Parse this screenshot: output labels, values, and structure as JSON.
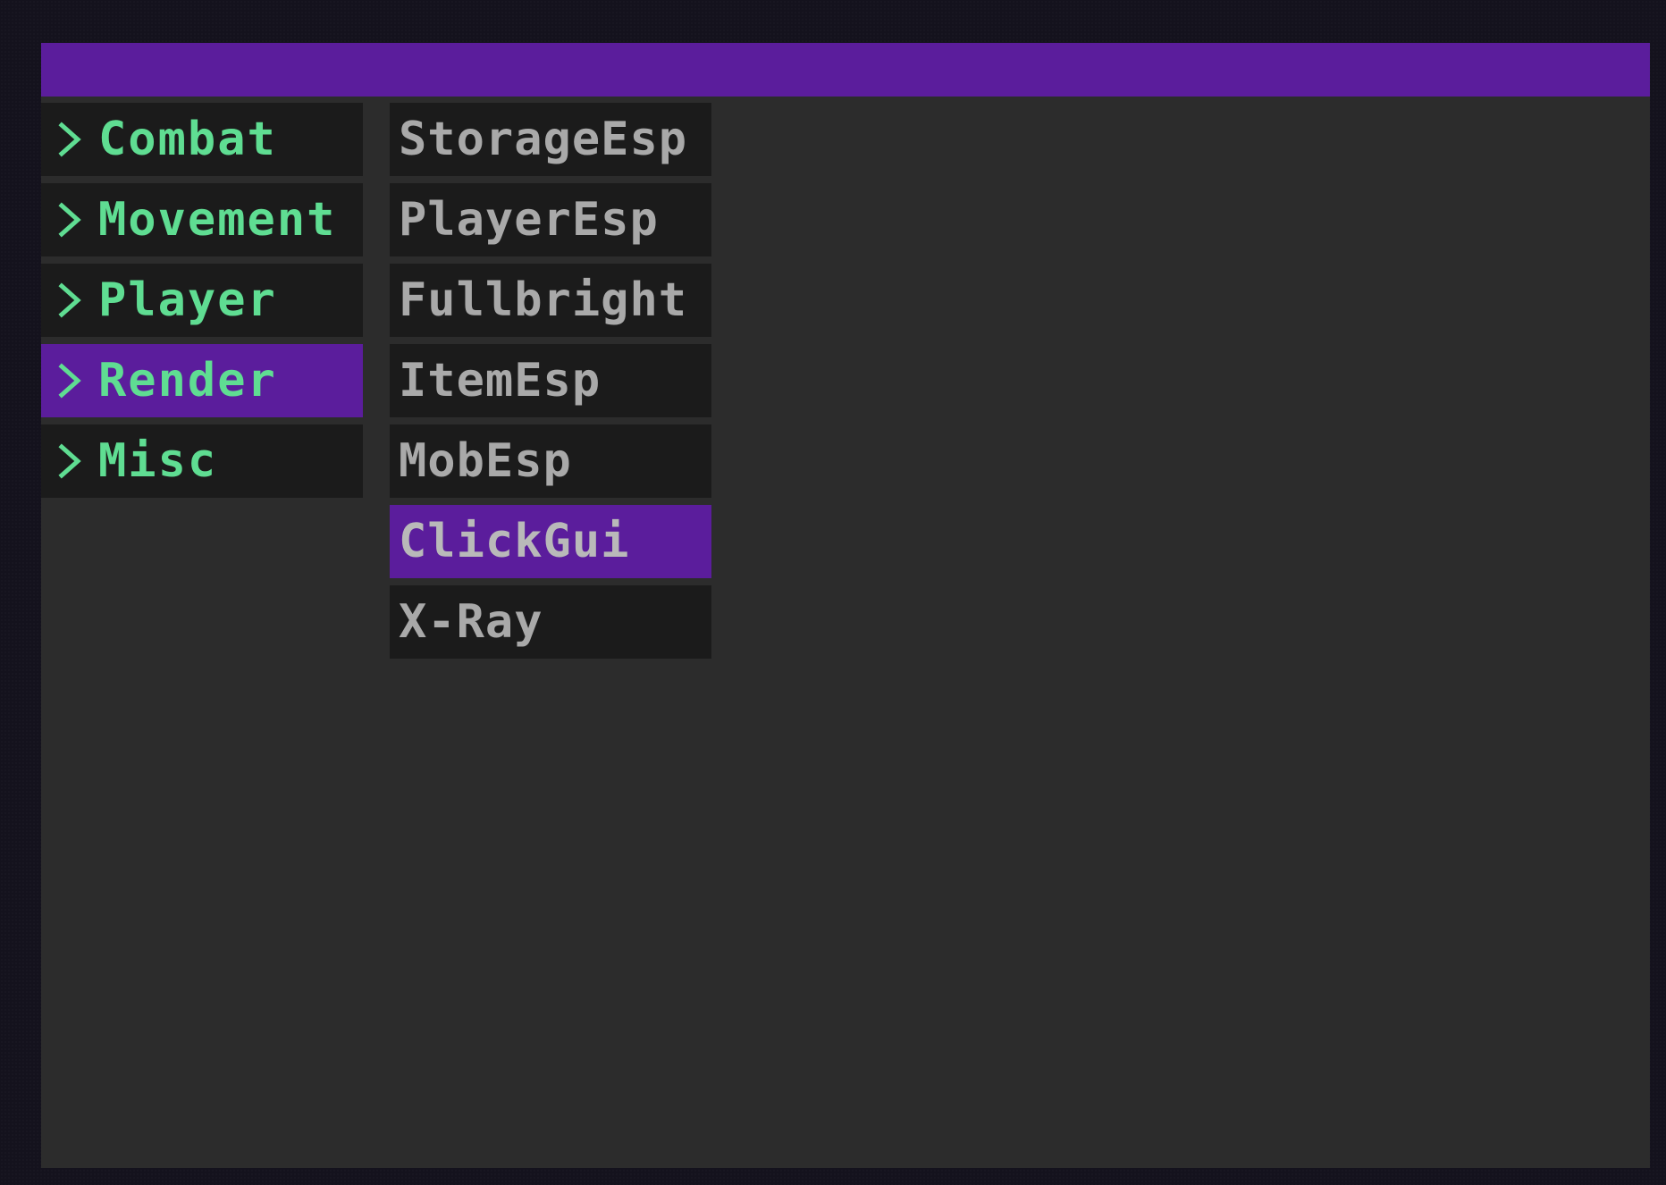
{
  "colors": {
    "accent": "#5b1d9c",
    "panel": "#2c2c2c",
    "item_bg": "#1b1b1b",
    "category_text": "#5fdd92",
    "module_text": "#a9a9a9",
    "backdrop": "#14121d"
  },
  "title_bar": {
    "label": ""
  },
  "categories": [
    {
      "label": "Combat",
      "icon": "chevron-right-icon",
      "selected": false
    },
    {
      "label": "Movement",
      "icon": "chevron-right-icon",
      "selected": false
    },
    {
      "label": "Player",
      "icon": "chevron-right-icon",
      "selected": false
    },
    {
      "label": "Render",
      "icon": "chevron-right-icon",
      "selected": true
    },
    {
      "label": "Misc",
      "icon": "chevron-right-icon",
      "selected": false
    }
  ],
  "modules": [
    {
      "label": "StorageEsp",
      "selected": false
    },
    {
      "label": "PlayerEsp",
      "selected": false
    },
    {
      "label": "Fullbright",
      "selected": false
    },
    {
      "label": "ItemEsp",
      "selected": false
    },
    {
      "label": "MobEsp",
      "selected": false
    },
    {
      "label": "ClickGui",
      "selected": true
    },
    {
      "label": "X-Ray",
      "selected": false
    }
  ]
}
